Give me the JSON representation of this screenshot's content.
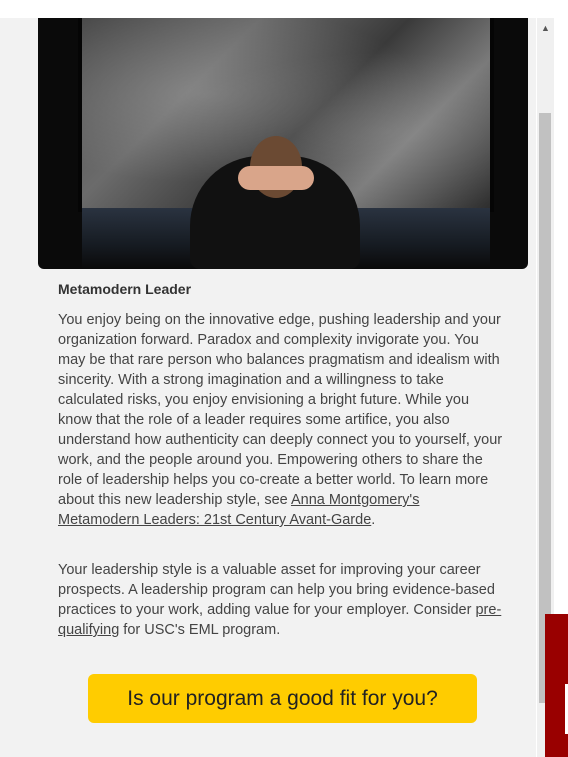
{
  "profile": {
    "title": "Metamodern Leader",
    "paragraph1_text": "You enjoy being on the innovative edge, pushing leadership and your organization forward. Paradox and complexity invigorate you. You may be that rare person who balances pragmatism and idealism with sincerity. With a strong imagination and a willingness to take calculated risks, you enjoy envisioning a bright future. While you know that the role of a leader requires some artifice, you also understand how authenticity can deeply connect you to yourself, your work, and the people around you. Empowering others to share the role of leadership helps you co-create a better world. To learn more about this new leadership style, see ",
    "paragraph1_link": "Anna Montgomery's Metamodern Leaders: 21st Century Avant-Garde",
    "paragraph1_end": ".",
    "paragraph2_text": "Your leadership style is a valuable asset for improving your career prospects. A leadership program can help you bring evidence-based practices to your work, adding value for your employer. Consider ",
    "paragraph2_link": "pre-qualifying",
    "paragraph2_end": " for USC's EML program."
  },
  "cta": {
    "label": "Is our program a good fit for you?"
  },
  "colors": {
    "cta_background": "#ffcc00",
    "side_tab": "#990000"
  },
  "icons": {
    "scroll_up": "triangle-up"
  }
}
